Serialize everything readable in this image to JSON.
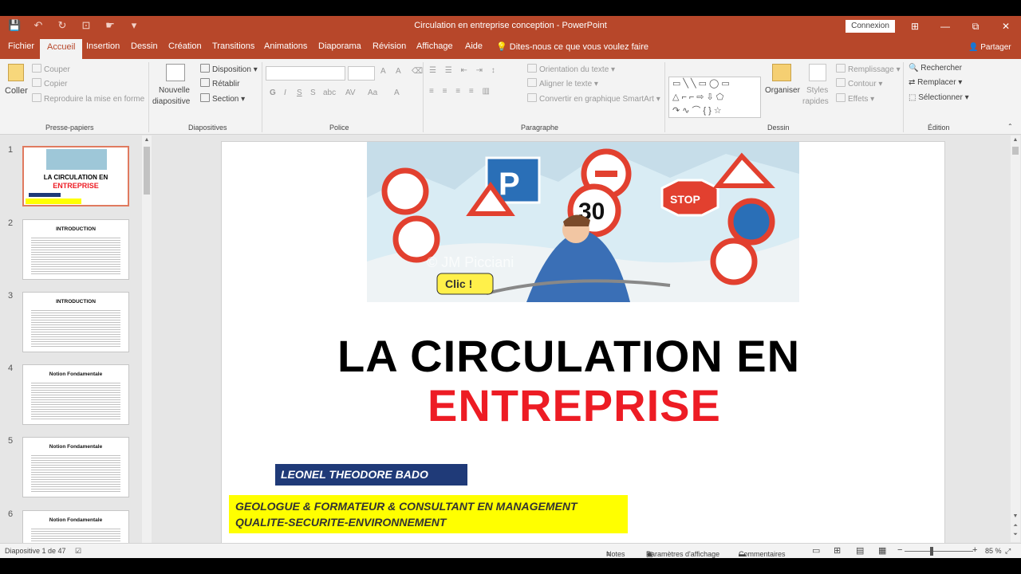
{
  "window": {
    "title": "Circulation en entreprise conception - PowerPoint",
    "connexion": "Connexion",
    "minimize": "—",
    "restore": "⧉",
    "close": "✕",
    "ribbon_toggle": "⊞"
  },
  "qat": {
    "save": "💾",
    "undo": "↶",
    "redo": "↻",
    "present": "⊡",
    "touch": "☛",
    "more": "▾"
  },
  "tabs": [
    "Fichier",
    "Accueil",
    "Insertion",
    "Dessin",
    "Création",
    "Transitions",
    "Animations",
    "Diaporama",
    "Révision",
    "Affichage",
    "Aide"
  ],
  "active_tab": "Accueil",
  "tell_me": "Dites-nous ce que vous voulez faire",
  "share": "Partager",
  "ribbon": {
    "clipboard": {
      "paste": "Coller",
      "cut": "Couper",
      "copy": "Copier",
      "format_painter": "Reproduire la mise en forme",
      "label": "Presse-papiers"
    },
    "slides": {
      "new_slide": "Nouvelle",
      "new_slide2": "diapositive",
      "layout": "Disposition",
      "reset": "Rétablir",
      "section": "Section",
      "label": "Diapositives"
    },
    "font": {
      "label": "Police",
      "bold": "G",
      "italic": "I",
      "underline": "S",
      "strike": "S",
      "shadow": "abc",
      "spacing": "AV",
      "case": "Aa",
      "color": "A",
      "grow": "A",
      "shrink": "A"
    },
    "paragraph": {
      "text_direction": "Orientation du texte",
      "align_text": "Aligner le texte",
      "smartart": "Convertir en graphique SmartArt",
      "label": "Paragraphe"
    },
    "drawing": {
      "arrange": "Organiser",
      "quick_styles": "Styles",
      "quick_styles2": "rapides",
      "fill": "Remplissage",
      "outline": "Contour",
      "effects": "Effets",
      "label": "Dessin",
      "shape_glyphs": "▭╲╲▭◯▭ △⌐⌐⇨⇩⬠ ↷∿⌒{}☆"
    },
    "editing": {
      "find": "Rechercher",
      "replace": "Remplacer",
      "select": "Sélectionner",
      "label": "Édition"
    }
  },
  "thumbnails": [
    {
      "num": "1",
      "title": "LA CIRCULATION EN",
      "title2": "ENTREPRISE"
    },
    {
      "num": "2",
      "title": "INTRODUCTION"
    },
    {
      "num": "3",
      "title": "INTRODUCTION"
    },
    {
      "num": "4",
      "title": "Notion Fondamentale"
    },
    {
      "num": "5",
      "title": "Notion Fondamentale"
    },
    {
      "num": "6",
      "title": "Notion Fondamentale"
    }
  ],
  "slide": {
    "title_line1": "LA CIRCULATION EN",
    "title_line2": "ENTREPRISE",
    "author": "LEONEL THEODORE BADO",
    "role_line1": "GEOLOGUE & FORMATEUR & CONSULTANT EN MANAGEMENT",
    "role_line2": "QUALITE-SECURITE-ENVIRONNEMENT",
    "sign_30": "30",
    "sign_stop": "STOP",
    "sign_p": "P",
    "bubble": "Clic !",
    "watermark": "© JM Picciani"
  },
  "status": {
    "slide_counter": "Diapositive 1 de 47",
    "notes": "Notes",
    "display_settings": "Paramètres d'affichage",
    "comments": "Commentaires",
    "zoom": "85 %",
    "minus": "−",
    "plus": "+"
  },
  "colors": {
    "accent": "#b7472a",
    "title_red": "#ed1c24",
    "author_bg": "#1f3a78",
    "role_bg": "#ffff00"
  }
}
